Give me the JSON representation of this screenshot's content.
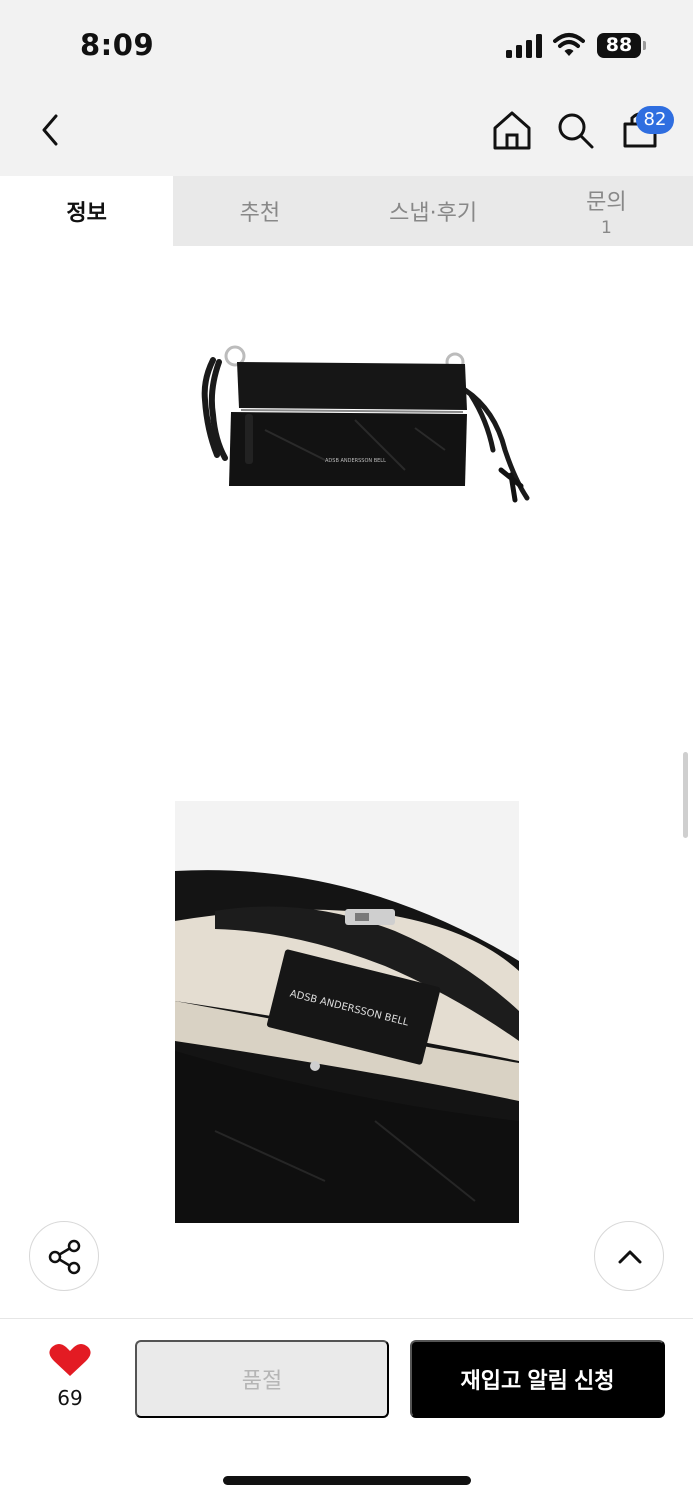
{
  "status_bar": {
    "time": "8:09",
    "battery": "88"
  },
  "nav": {
    "cart_count": "82"
  },
  "tabs": [
    {
      "label": "정보",
      "count": ""
    },
    {
      "label": "추천",
      "count": ""
    },
    {
      "label": "스냅·후기",
      "count": ""
    },
    {
      "label": "문의",
      "count": "1"
    }
  ],
  "product": {
    "brand_label": "ADSB ANDERSSON BELL"
  },
  "actions": {
    "like_count": "69",
    "soldout_label": "품절",
    "restock_label": "재입고 알림 신청"
  },
  "colors": {
    "accent_badge": "#2f6ee0",
    "heart": "#e31b23",
    "primary_button": "#000000"
  }
}
